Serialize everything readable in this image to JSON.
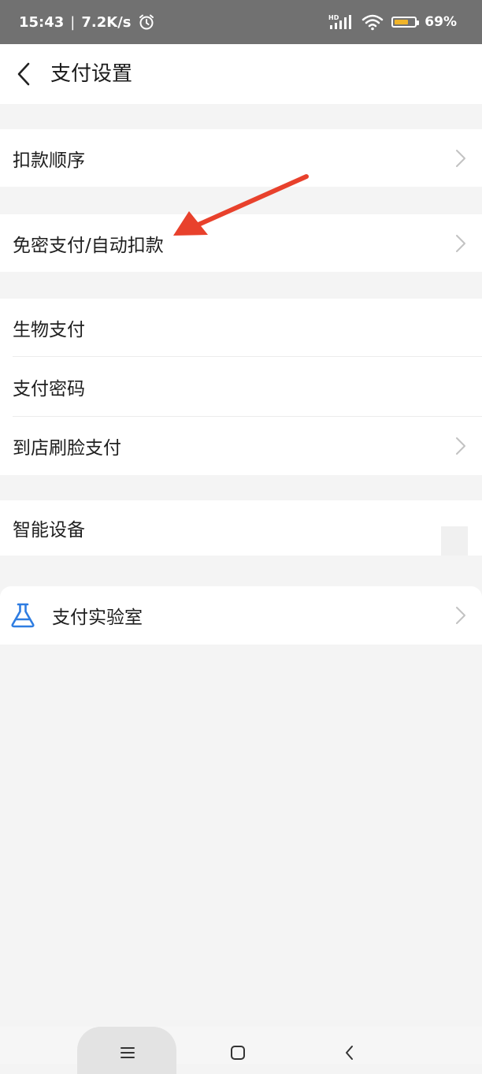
{
  "status_bar": {
    "time": "15:43",
    "separator": "|",
    "speed": "7.2K/s",
    "battery": "69%",
    "battery_level": 0.69,
    "icons": [
      "alarm-icon",
      "hd-signal-icon",
      "wifi-icon",
      "battery-icon"
    ]
  },
  "header": {
    "title": "支付设置",
    "back_icon": "chevron-left-icon"
  },
  "settings": {
    "deduction_order": "扣款顺序",
    "auto_pay": "免密支付/自动扣款",
    "biometric_pay": "生物支付",
    "pay_password": "支付密码",
    "face_pay_in_store": "到店刷脸支付",
    "smart_devices": "智能设备",
    "pay_lab": "支付实验室"
  },
  "annotation": {
    "arrow_color": "#e8412c"
  },
  "nav_bar": {
    "icons": [
      "menu-icon",
      "home-icon",
      "back-icon"
    ]
  },
  "colors": {
    "status_bar_bg": "#717171",
    "page_bg": "#f4f4f4",
    "row_bg": "#ffffff",
    "lab_icon": "#2f7de1",
    "battery_fill": "#f0b429"
  }
}
